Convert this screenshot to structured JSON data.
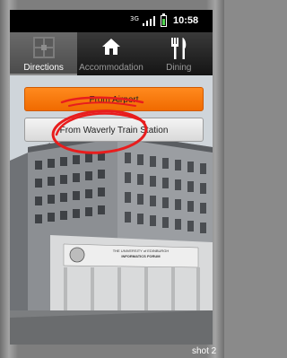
{
  "status_bar": {
    "sim_label": "3G",
    "time": "10:58",
    "battery_level": 0.7
  },
  "tabs": [
    {
      "label": "Directions",
      "icon": "directions-grid-icon",
      "active": true
    },
    {
      "label": "Accommodation",
      "icon": "home-icon",
      "active": false
    },
    {
      "label": "Dining",
      "icon": "cutlery-icon",
      "active": false
    }
  ],
  "buttons": {
    "from_airport": "From Airport",
    "from_train": "From Waverly Train Station"
  },
  "background_image": {
    "sign_text_line1": "THE UNIVERSITY of EDINBURGH",
    "sign_text_line2": "INFORMATICS FORUM"
  },
  "footer_label": "shot 2",
  "colors": {
    "accent_orange": "#f57a10",
    "annotation_red": "#e81d1d",
    "tab_active": "#555555"
  }
}
